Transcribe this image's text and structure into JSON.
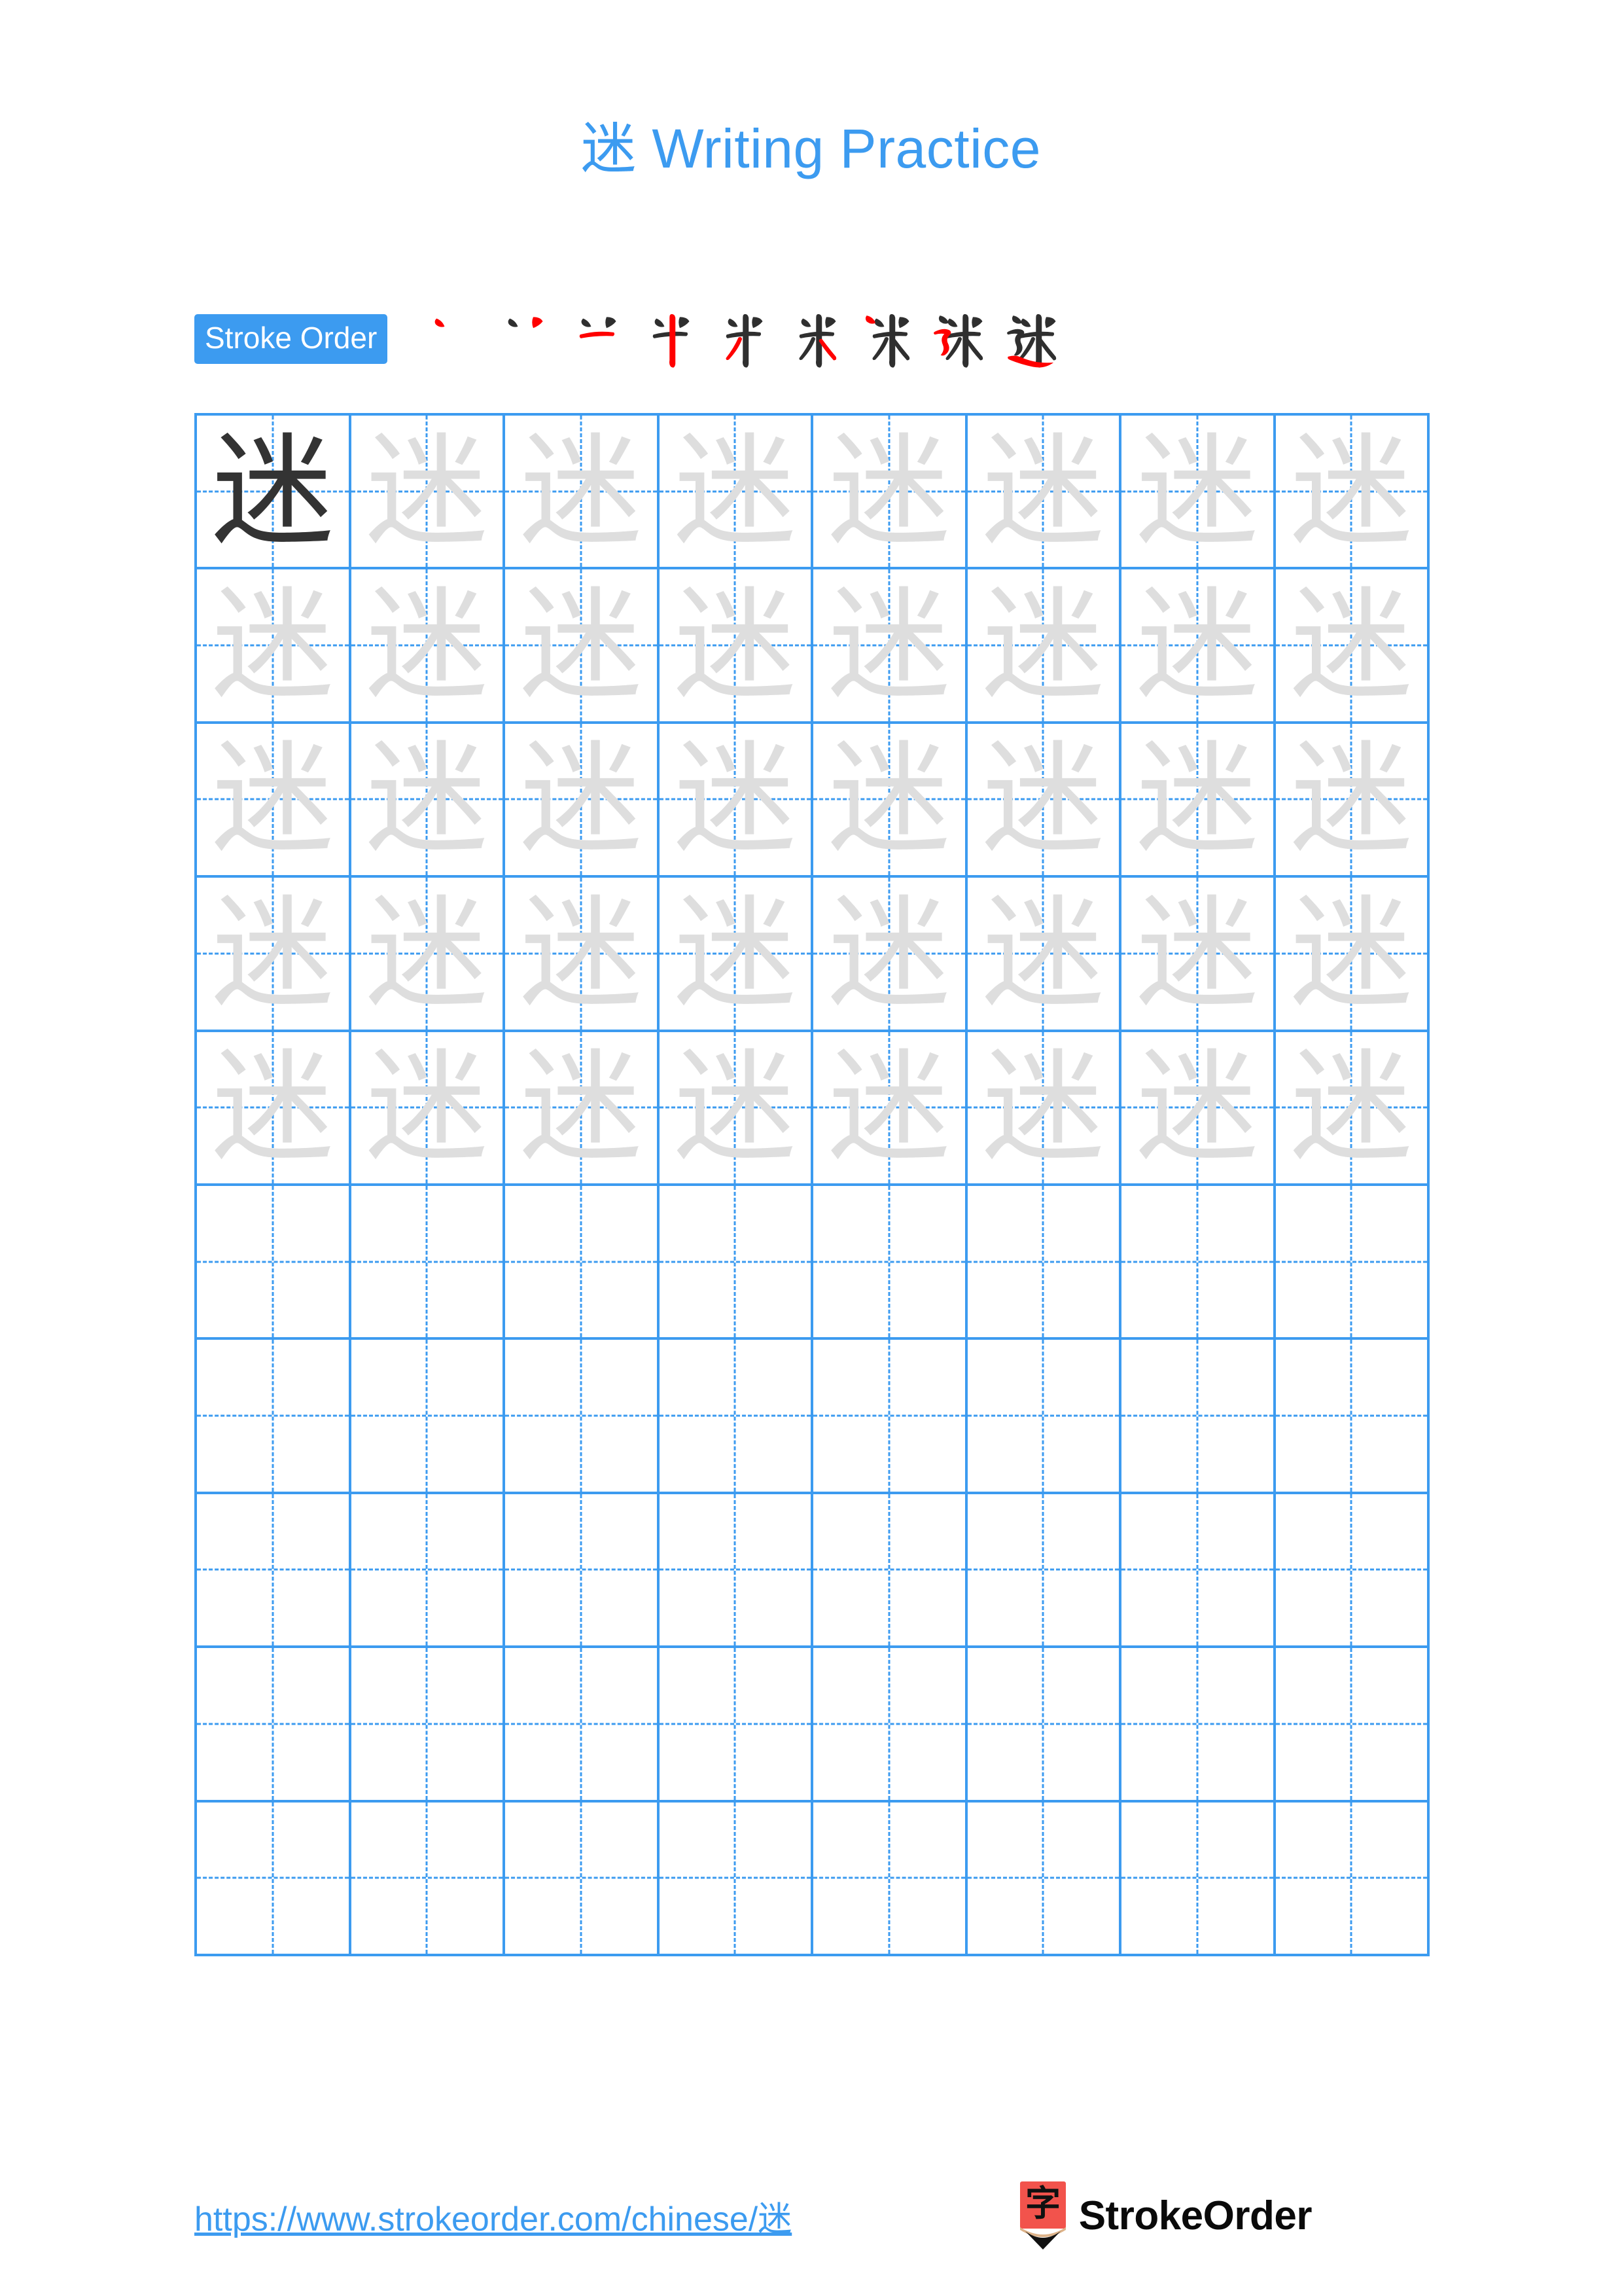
{
  "page": {
    "background_color": "#ffffff",
    "accent_color": "#3C9BF0",
    "character": "迷",
    "trace_color": "#DEDEDE",
    "model_color": "#333333"
  },
  "header": {
    "title_char": "迷",
    "title_text": " Writing Practice",
    "title_full": "迷 Writing Practice"
  },
  "stroke_order": {
    "badge_label": "Stroke Order",
    "stroke_count": 9,
    "new_stroke_color": "#FF0000",
    "old_stroke_color": "#2F2F2F",
    "stages": [
      {
        "index": 1,
        "name": "stroke-stage-1",
        "partial": "丶"
      },
      {
        "index": 2,
        "name": "stroke-stage-2",
        "partial": "丷"
      },
      {
        "index": 3,
        "name": "stroke-stage-3",
        "partial": "丷一"
      },
      {
        "index": 4,
        "name": "stroke-stage-4",
        "partial": "半"
      },
      {
        "index": 5,
        "name": "stroke-stage-5",
        "partial": "半丿"
      },
      {
        "index": 6,
        "name": "stroke-stage-6",
        "partial": "米"
      },
      {
        "index": 7,
        "name": "stroke-stage-7",
        "partial": "丶米"
      },
      {
        "index": 8,
        "name": "stroke-stage-8",
        "partial": "辶米"
      },
      {
        "index": 9,
        "name": "stroke-stage-9",
        "partial": "迷"
      }
    ]
  },
  "grid": {
    "columns": 8,
    "rows": 10,
    "line_color": "#3C9BF0",
    "guide_style": "dashed-crosshair",
    "cells": [
      {
        "row": 1,
        "col": 1,
        "char": "迷",
        "style": "dark"
      },
      {
        "row": 1,
        "col": 2,
        "char": "迷",
        "style": "trace"
      },
      {
        "row": 1,
        "col": 3,
        "char": "迷",
        "style": "trace"
      },
      {
        "row": 1,
        "col": 4,
        "char": "迷",
        "style": "trace"
      },
      {
        "row": 1,
        "col": 5,
        "char": "迷",
        "style": "trace"
      },
      {
        "row": 1,
        "col": 6,
        "char": "迷",
        "style": "trace"
      },
      {
        "row": 1,
        "col": 7,
        "char": "迷",
        "style": "trace"
      },
      {
        "row": 1,
        "col": 8,
        "char": "迷",
        "style": "trace"
      },
      {
        "row": 2,
        "col": 1,
        "char": "迷",
        "style": "trace"
      },
      {
        "row": 2,
        "col": 2,
        "char": "迷",
        "style": "trace"
      },
      {
        "row": 2,
        "col": 3,
        "char": "迷",
        "style": "trace"
      },
      {
        "row": 2,
        "col": 4,
        "char": "迷",
        "style": "trace"
      },
      {
        "row": 2,
        "col": 5,
        "char": "迷",
        "style": "trace"
      },
      {
        "row": 2,
        "col": 6,
        "char": "迷",
        "style": "trace"
      },
      {
        "row": 2,
        "col": 7,
        "char": "迷",
        "style": "trace"
      },
      {
        "row": 2,
        "col": 8,
        "char": "迷",
        "style": "trace"
      },
      {
        "row": 3,
        "col": 1,
        "char": "迷",
        "style": "trace"
      },
      {
        "row": 3,
        "col": 2,
        "char": "迷",
        "style": "trace"
      },
      {
        "row": 3,
        "col": 3,
        "char": "迷",
        "style": "trace"
      },
      {
        "row": 3,
        "col": 4,
        "char": "迷",
        "style": "trace"
      },
      {
        "row": 3,
        "col": 5,
        "char": "迷",
        "style": "trace"
      },
      {
        "row": 3,
        "col": 6,
        "char": "迷",
        "style": "trace"
      },
      {
        "row": 3,
        "col": 7,
        "char": "迷",
        "style": "trace"
      },
      {
        "row": 3,
        "col": 8,
        "char": "迷",
        "style": "trace"
      },
      {
        "row": 4,
        "col": 1,
        "char": "迷",
        "style": "trace"
      },
      {
        "row": 4,
        "col": 2,
        "char": "迷",
        "style": "trace"
      },
      {
        "row": 4,
        "col": 3,
        "char": "迷",
        "style": "trace"
      },
      {
        "row": 4,
        "col": 4,
        "char": "迷",
        "style": "trace"
      },
      {
        "row": 4,
        "col": 5,
        "char": "迷",
        "style": "trace"
      },
      {
        "row": 4,
        "col": 6,
        "char": "迷",
        "style": "trace"
      },
      {
        "row": 4,
        "col": 7,
        "char": "迷",
        "style": "trace"
      },
      {
        "row": 4,
        "col": 8,
        "char": "迷",
        "style": "trace"
      },
      {
        "row": 5,
        "col": 1,
        "char": "迷",
        "style": "trace"
      },
      {
        "row": 5,
        "col": 2,
        "char": "迷",
        "style": "trace"
      },
      {
        "row": 5,
        "col": 3,
        "char": "迷",
        "style": "trace"
      },
      {
        "row": 5,
        "col": 4,
        "char": "迷",
        "style": "trace"
      },
      {
        "row": 5,
        "col": 5,
        "char": "迷",
        "style": "trace"
      },
      {
        "row": 5,
        "col": 6,
        "char": "迷",
        "style": "trace"
      },
      {
        "row": 5,
        "col": 7,
        "char": "迷",
        "style": "trace"
      },
      {
        "row": 5,
        "col": 8,
        "char": "迷",
        "style": "trace"
      },
      {
        "row": 6,
        "col": 1,
        "char": "",
        "style": "empty"
      },
      {
        "row": 6,
        "col": 2,
        "char": "",
        "style": "empty"
      },
      {
        "row": 6,
        "col": 3,
        "char": "",
        "style": "empty"
      },
      {
        "row": 6,
        "col": 4,
        "char": "",
        "style": "empty"
      },
      {
        "row": 6,
        "col": 5,
        "char": "",
        "style": "empty"
      },
      {
        "row": 6,
        "col": 6,
        "char": "",
        "style": "empty"
      },
      {
        "row": 6,
        "col": 7,
        "char": "",
        "style": "empty"
      },
      {
        "row": 6,
        "col": 8,
        "char": "",
        "style": "empty"
      },
      {
        "row": 7,
        "col": 1,
        "char": "",
        "style": "empty"
      },
      {
        "row": 7,
        "col": 2,
        "char": "",
        "style": "empty"
      },
      {
        "row": 7,
        "col": 3,
        "char": "",
        "style": "empty"
      },
      {
        "row": 7,
        "col": 4,
        "char": "",
        "style": "empty"
      },
      {
        "row": 7,
        "col": 5,
        "char": "",
        "style": "empty"
      },
      {
        "row": 7,
        "col": 6,
        "char": "",
        "style": "empty"
      },
      {
        "row": 7,
        "col": 7,
        "char": "",
        "style": "empty"
      },
      {
        "row": 7,
        "col": 8,
        "char": "",
        "style": "empty"
      },
      {
        "row": 8,
        "col": 1,
        "char": "",
        "style": "empty"
      },
      {
        "row": 8,
        "col": 2,
        "char": "",
        "style": "empty"
      },
      {
        "row": 8,
        "col": 3,
        "char": "",
        "style": "empty"
      },
      {
        "row": 8,
        "col": 4,
        "char": "",
        "style": "empty"
      },
      {
        "row": 8,
        "col": 5,
        "char": "",
        "style": "empty"
      },
      {
        "row": 8,
        "col": 6,
        "char": "",
        "style": "empty"
      },
      {
        "row": 8,
        "col": 7,
        "char": "",
        "style": "empty"
      },
      {
        "row": 8,
        "col": 8,
        "char": "",
        "style": "empty"
      },
      {
        "row": 9,
        "col": 1,
        "char": "",
        "style": "empty"
      },
      {
        "row": 9,
        "col": 2,
        "char": "",
        "style": "empty"
      },
      {
        "row": 9,
        "col": 3,
        "char": "",
        "style": "empty"
      },
      {
        "row": 9,
        "col": 4,
        "char": "",
        "style": "empty"
      },
      {
        "row": 9,
        "col": 5,
        "char": "",
        "style": "empty"
      },
      {
        "row": 9,
        "col": 6,
        "char": "",
        "style": "empty"
      },
      {
        "row": 9,
        "col": 7,
        "char": "",
        "style": "empty"
      },
      {
        "row": 9,
        "col": 8,
        "char": "",
        "style": "empty"
      },
      {
        "row": 10,
        "col": 1,
        "char": "",
        "style": "empty"
      },
      {
        "row": 10,
        "col": 2,
        "char": "",
        "style": "empty"
      },
      {
        "row": 10,
        "col": 3,
        "char": "",
        "style": "empty"
      },
      {
        "row": 10,
        "col": 4,
        "char": "",
        "style": "empty"
      },
      {
        "row": 10,
        "col": 5,
        "char": "",
        "style": "empty"
      },
      {
        "row": 10,
        "col": 6,
        "char": "",
        "style": "empty"
      },
      {
        "row": 10,
        "col": 7,
        "char": "",
        "style": "empty"
      },
      {
        "row": 10,
        "col": 8,
        "char": "",
        "style": "empty"
      }
    ]
  },
  "footer": {
    "url": "https://www.strokeorder.com/chinese/迷",
    "logo_char": "字",
    "logo_wordmark": "StrokeOrder",
    "logo_body_color": "#F2534C",
    "logo_wood_color": "#DDB38A",
    "logo_tip_color": "#111111"
  }
}
